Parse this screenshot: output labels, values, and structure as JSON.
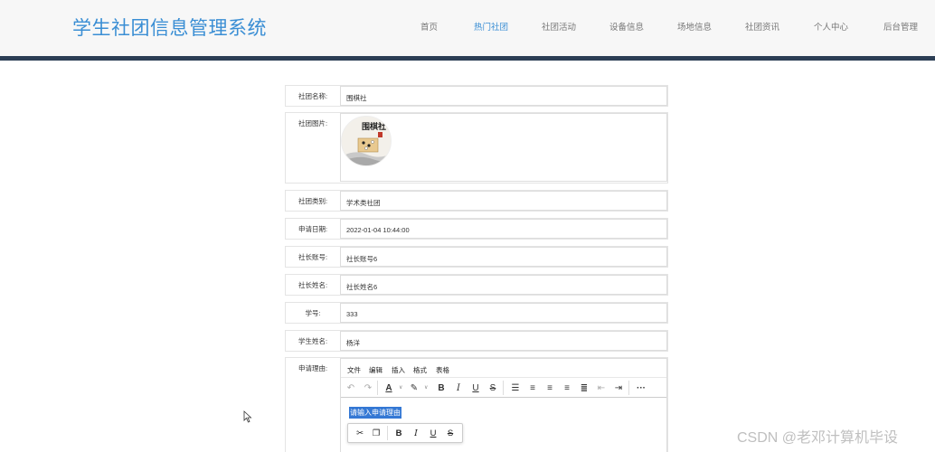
{
  "header": {
    "brand": "学生社团信息管理系统",
    "nav": [
      {
        "label": "首页",
        "active": false
      },
      {
        "label": "热门社团",
        "active": true
      },
      {
        "label": "社团活动",
        "active": false
      },
      {
        "label": "设备信息",
        "active": false
      },
      {
        "label": "场地信息",
        "active": false
      },
      {
        "label": "社团资讯",
        "active": false
      },
      {
        "label": "个人中心",
        "active": false
      },
      {
        "label": "后台管理",
        "active": false
      }
    ],
    "accent_color": "#3a8ed4",
    "bar_color": "#2c3e55"
  },
  "form": {
    "club_name": {
      "label": "社团名称:",
      "value": "围棋社"
    },
    "club_image": {
      "label": "社团图片:",
      "image_text": "围棋社"
    },
    "club_type": {
      "label": "社团类别:",
      "value": "学术类社团"
    },
    "apply_date": {
      "label": "申请日期:",
      "value": "2022-01-04 10:44:00"
    },
    "leader_account": {
      "label": "社长账号:",
      "value": "社长账号6"
    },
    "leader_name": {
      "label": "社长姓名:",
      "value": "社长姓名6"
    },
    "student_id": {
      "label": "学号:",
      "value": "333"
    },
    "student_name": {
      "label": "学生姓名:",
      "value": "杨洋"
    },
    "reason": {
      "label": "申请理由:",
      "menu": [
        "文件",
        "编辑",
        "插入",
        "格式",
        "表格"
      ],
      "content": "请输入申请理由",
      "selection_color": "#3478d4"
    }
  },
  "toolbar_icons": [
    "undo-icon",
    "redo-icon",
    "text-color-icon",
    "highlight-icon",
    "bold-icon",
    "italic-icon",
    "underline-icon",
    "strikethrough-icon",
    "line-height-icon",
    "align-left-icon",
    "align-center-icon",
    "align-right-icon",
    "justify-icon",
    "outdent-icon",
    "indent-icon",
    "more-icon"
  ],
  "floating_toolbar_icons": [
    "cut-icon",
    "copy-icon",
    "bold-icon",
    "italic-icon",
    "underline-icon",
    "strikethrough-icon"
  ],
  "watermark": "CSDN @老邓计算机毕设"
}
